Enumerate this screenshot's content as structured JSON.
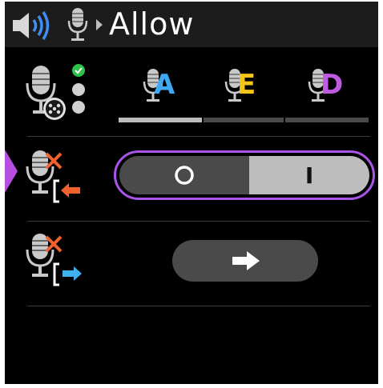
{
  "header": {
    "title": "Allow",
    "icons": [
      "speaker-icon",
      "microphone-icon",
      "breadcrumb-arrow-icon"
    ]
  },
  "modes": [
    {
      "letter": "A",
      "color": "#3fa9f5"
    },
    {
      "letter": "E",
      "color": "#f5c518"
    },
    {
      "letter": "D",
      "color": "#c05ae0"
    }
  ],
  "mode_status": {
    "active_index": 0,
    "indicator_colors": [
      "#2ec24a",
      "#d0d0d0",
      "#d0d0d0"
    ]
  },
  "auto_mute_in": {
    "off_label": "O",
    "on_label": "I",
    "state": "on",
    "accent": "#a855e8"
  },
  "auto_mute_out": {
    "button_icon": "right-arrow-icon"
  },
  "colors": {
    "mute_x": "#f2622e",
    "arrow_in": "#f2622e",
    "arrow_out": "#3fb0f0",
    "selection": "#b44fe0"
  }
}
